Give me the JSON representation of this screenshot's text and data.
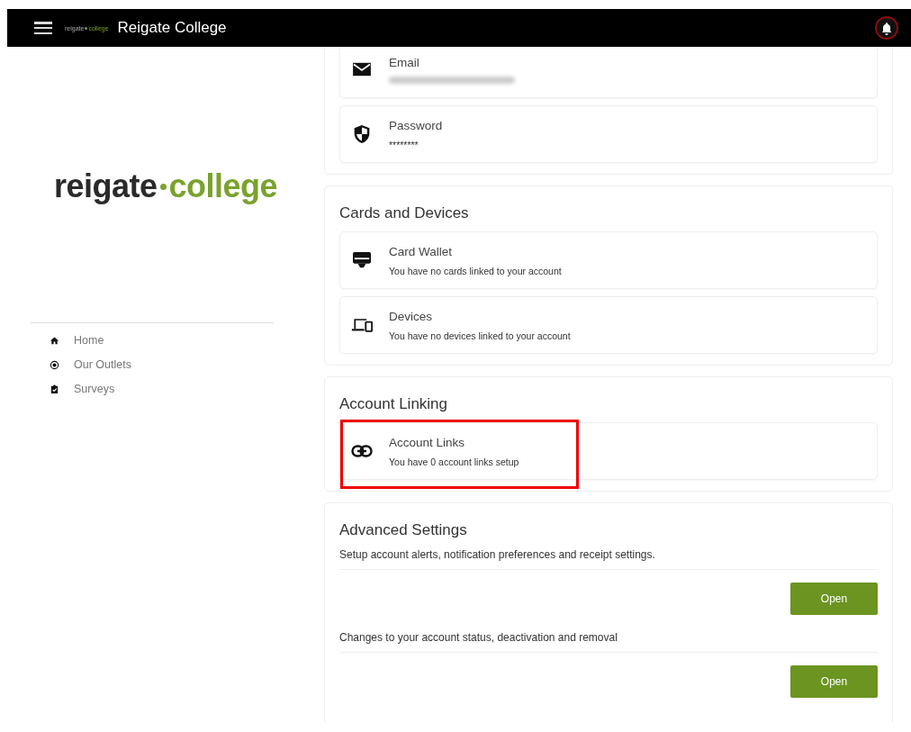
{
  "header": {
    "logo": {
      "first": "reigate",
      "second": "college"
    },
    "title": "Reigate College"
  },
  "sidebar": {
    "logo": {
      "first": "reigate",
      "second": "college"
    },
    "items": [
      {
        "label": "Home"
      },
      {
        "label": "Our Outlets"
      },
      {
        "label": "Surveys"
      }
    ]
  },
  "sections": [
    {
      "items": [
        {
          "label": "Email",
          "redacted": true
        },
        {
          "label": "Password",
          "value": "********"
        }
      ]
    },
    {
      "title": "Cards and Devices",
      "items": [
        {
          "label": "Card Wallet",
          "value": "You have no cards linked to your account"
        },
        {
          "label": "Devices",
          "value": "You have no devices linked to your account"
        }
      ]
    },
    {
      "title": "Account Linking",
      "items": [
        {
          "label": "Account Links",
          "value": "You have 0 account links setup",
          "highlighted": true
        }
      ]
    }
  ],
  "advanced": {
    "title": "Advanced Settings",
    "rows": [
      {
        "text": "Setup account alerts, notification preferences and receipt settings.",
        "button": "Open"
      },
      {
        "text": "Changes to your account status, deactivation and removal",
        "button": "Open"
      }
    ]
  }
}
